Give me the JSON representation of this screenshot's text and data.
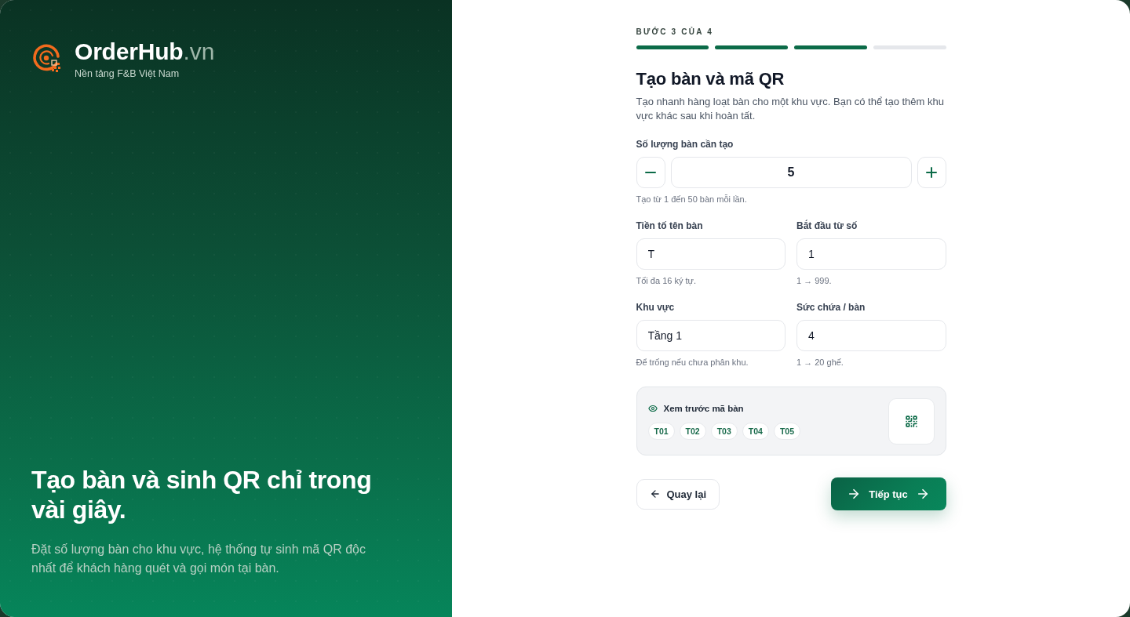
{
  "brand": {
    "name": "OrderHub",
    "suffix": ".vn",
    "tagline": "Nền tảng F&B Việt Nam"
  },
  "hero": {
    "headline": "Tạo bàn và sinh QR chỉ trong vài giây.",
    "text": "Đặt số lượng bàn cho khu vực, hệ thống tự sinh mã QR độc nhất để khách hàng quét và gọi món tại bàn."
  },
  "form": {
    "step_label": "BƯỚC 3 CỦA 4",
    "steps": [
      {
        "completed": true
      },
      {
        "completed": true
      },
      {
        "completed": true
      },
      {
        "completed": false
      }
    ],
    "title": "Tạo bàn và mã QR",
    "description": "Tạo nhanh hàng loạt bàn cho một khu vực. Bạn có thể tạo thêm khu vực khác sau khi hoàn tất.",
    "quantity": {
      "label": "Số lượng bàn cần tạo",
      "value": "5",
      "hint": "Tạo từ 1 đến 50 bàn mỗi lần."
    },
    "fields": [
      {
        "label": "Tiền tố tên bàn",
        "value": "T",
        "hint": "Tối đa 16 ký tự."
      },
      {
        "label": "Bắt đầu từ số",
        "value": "1",
        "hint": "1 → 999."
      },
      {
        "label": "Khu vực",
        "value": "Tầng 1",
        "hint": "Để trống nếu chưa phân khu."
      },
      {
        "label": "Sức chứa / bàn",
        "value": "4",
        "hint": "1 → 20 ghế."
      }
    ],
    "preview": {
      "title": "Xem trước mã bàn",
      "codes": [
        "T01",
        "T02",
        "T03",
        "T04",
        "T05"
      ]
    },
    "buttons": [
      {
        "kind": "back",
        "label": "Quay lại"
      },
      {
        "kind": "next",
        "label": "Tiếp tục"
      }
    ]
  }
}
